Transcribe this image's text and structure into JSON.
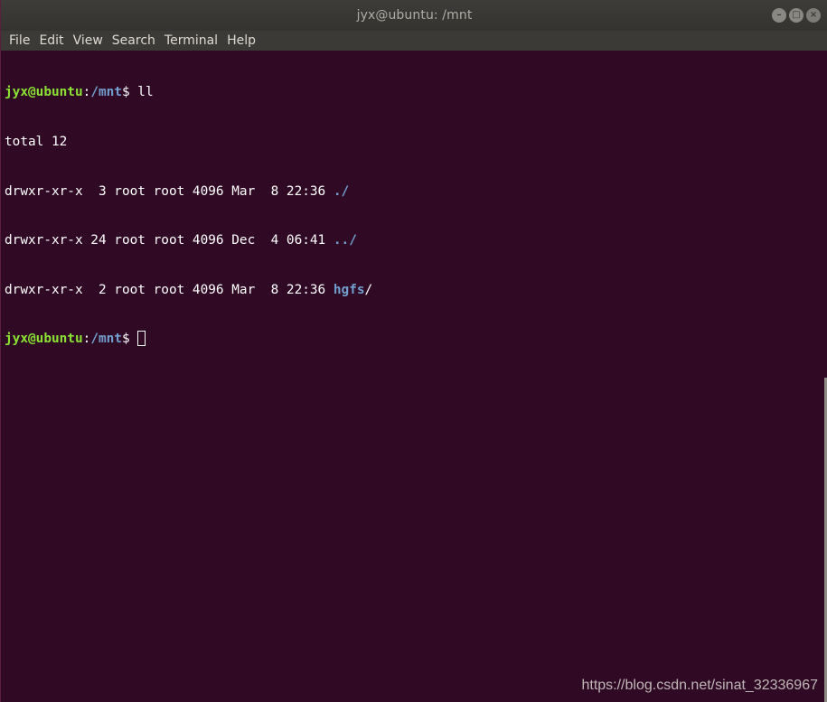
{
  "window": {
    "title": "jyx@ubuntu: /mnt",
    "controls": {
      "minimize": "–",
      "maximize": "□",
      "close": "×"
    }
  },
  "menu": [
    "File",
    "Edit",
    "View",
    "Search",
    "Terminal",
    "Help"
  ],
  "terminal": {
    "prompt_user": "jyx@ubuntu",
    "prompt_path": "/mnt",
    "command": " ll",
    "total": "total 12",
    "entries": [
      {
        "meta": "drwxr-xr-x  3 root root 4096 Mar  8 22:36 ",
        "name": "./",
        "suffix": ""
      },
      {
        "meta": "drwxr-xr-x 24 root root 4096 Dec  4 06:41 ",
        "name": "../",
        "suffix": ""
      },
      {
        "meta": "drwxr-xr-x  2 root root 4096 Mar  8 22:36 ",
        "name": "hgfs",
        "suffix": "/"
      }
    ]
  },
  "watermark": "https://blog.csdn.net/sinat_32336967",
  "colors": {
    "background": "#300a24",
    "prompt_user": "#8ae234",
    "prompt_path": "#729fcf"
  }
}
